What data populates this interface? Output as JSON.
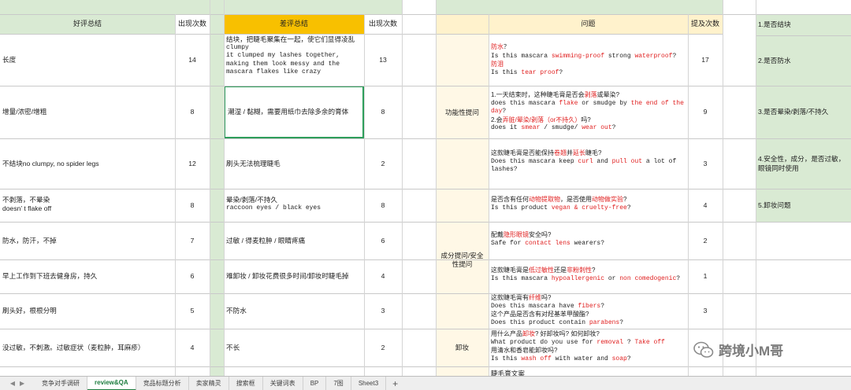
{
  "colors": {
    "green_header": "#d9ead3",
    "orange_header": "#f8c000",
    "cream_header": "#fff2cc",
    "cream_cell": "#fff8e6",
    "green_col": "#d9ead3",
    "selection": "#2e9e5b",
    "red_text": "#e02020"
  },
  "good": {
    "header_label": "好评总结",
    "count_header": "出现次数",
    "rows": [
      {
        "text": "长度",
        "count": "14"
      },
      {
        "text": "增量/浓密/增粗",
        "count": "8"
      },
      {
        "text": "不结块no clumpy, no spider legs",
        "count": "12"
      },
      {
        "text_line1": "不剥落，不晕染",
        "text_line2": "doesn’ t flake off",
        "count": "8"
      },
      {
        "text": "防水，防汗，不掉",
        "count": "7"
      },
      {
        "text": "早上工作到下班去健身房，持久",
        "count": "6"
      },
      {
        "text": "刷头好，根根分明",
        "count": "5"
      },
      {
        "text": "没过敏，不刺激。过敏症状（麦粒肿，耳麻疹）",
        "count": "4"
      }
    ]
  },
  "bad": {
    "header_label": "差评总结",
    "count_header": "出现次数",
    "row1": {
      "lines": [
        "结块，把睫毛聚集在一起，使它们显得凌乱",
        "clumpy",
        "it clumped my lashes together,",
        "making them look messy and the",
        "mascara flakes like crazy"
      ],
      "count": "13"
    },
    "rows": [
      {
        "text": "潮湿 / 黏糊，需要用纸巾去除多余的膏体",
        "count": "8"
      },
      {
        "text": "刷头无法梳理睫毛",
        "count": "2"
      },
      {
        "text_line1": "晕染/剥落/不持久",
        "text_line2": "raccoon eyes / black eyes",
        "count": "8"
      },
      {
        "text": "过敏 / 得麦粒肿 / 眼睛疼痛",
        "count": "6"
      },
      {
        "text": "难卸妆 / 卸妆花费很多时间/卸妆时睫毛掉",
        "count": "4"
      },
      {
        "text": "不防水",
        "count": "3"
      },
      {
        "text": "不长",
        "count": "2"
      }
    ]
  },
  "qa": {
    "question_header": "问题",
    "count_header": "提及次数",
    "categories": {
      "functional": "功能性提问",
      "ingredients": "成分提问/安全性提问",
      "removal": "卸妆"
    },
    "q1": {
      "l1a": "防水",
      "l1b": "？",
      "l2a": "Is this mascara ",
      "l2b": "swimming-proof",
      "l2c": " strong ",
      "l2d": "waterproof",
      "l2e": "?",
      "l3": "防泪",
      "l4a": "Is this ",
      "l4b": "tear proof",
      "l4c": "?",
      "count": "17"
    },
    "q2": {
      "l1a": "1.一天结束时，这种睫毛膏是否会",
      "l1b": "剥落",
      "l1c": "或晕染?",
      "l2a": "does this mascara ",
      "l2b": "flake",
      "l2c": " or smudge by ",
      "l2d": "the end of the day",
      "l2e": "?",
      "l3a": "2.会",
      "l3b": "弄脏/晕染/剥落（or不持久）",
      "l3c": "吗?",
      "l4a": "does it ",
      "l4b": "smear",
      "l4c": " / smudge/ ",
      "l4d": "wear out",
      "l4e": "?",
      "count": "9"
    },
    "q3": {
      "l1a": "这款睫毛膏是否能保持",
      "l1b": "卷翘",
      "l1c": "并",
      "l1d": "延长",
      "l1e": "睫毛?",
      "l2a": "Does this mascara keep ",
      "l2b": "curl",
      "l2c": " and ",
      "l2d": "pull out",
      "l2e": " a lot of lashes?",
      "count": "3"
    },
    "q4": {
      "l1a": "是否含有任何",
      "l1b": "动物提取物",
      "l1c": "，是否使用",
      "l1d": "动物做实验",
      "l1e": "?",
      "l2a": "Is this product ",
      "l2b": "vegan & cruelty-free",
      "l2c": "?",
      "count": "4"
    },
    "q5": {
      "l1a": "配戴",
      "l1b": "隐形眼镜",
      "l1c": "安全吗?",
      "l2a": "Safe for ",
      "l2b": "contact lens",
      "l2c": " wearers?",
      "count": "2"
    },
    "q6": {
      "l1a": "这款睫毛膏是",
      "l1b": "低过敏性",
      "l1c": "还是",
      "l1d": "非粉刺性",
      "l1e": "?",
      "l2a": "Is this mascara ",
      "l2b": "hypoallergenic",
      "l2c": " or ",
      "l2d": "non comedogenic",
      "l2e": "?",
      "count": "1"
    },
    "q7": {
      "l1a": "这款睫毛膏有",
      "l1b": "纤维",
      "l1c": "吗?",
      "l2a": "Does this mascara have ",
      "l2b": "fibers",
      "l2c": "?",
      "l3": "这个产品是否含有对羟基苯甲酸酯?",
      "l4a": "Does this product contain ",
      "l4b": "parabens",
      "l4c": "?",
      "count": "3"
    },
    "q8": {
      "l1a": "用什么产品",
      "l1b": "卸妆",
      "l1c": "? 好卸妆吗? 如何卸妆?",
      "l2a": "What product do you use for ",
      "l2b": "removal",
      "l2c": " ? ",
      "l2d": "Take off",
      "l3": "用清水和香皂能卸妆吗?",
      "l4a": "Is this ",
      "l4b": "wash off",
      "l4c": " with water and ",
      "l4d": "soap",
      "l4e": "?"
    },
    "q9_partial": "睫毛膏文案"
  },
  "summary": {
    "items": [
      "1.是否结块",
      "2.是否防水",
      "3.是否晕染/剥落/不持久",
      "4.安全性，成分，是否过敏，眼镜同时使用",
      "5.卸妆问题"
    ]
  },
  "tabs": [
    "竞争对手调研",
    "review&QA",
    "竞品标题分析",
    "卖家精灵",
    "搜索框",
    "关键词表",
    "BP",
    "7图",
    "Sheet3"
  ],
  "tabs_add": "+",
  "watermark": "跨境小M哥"
}
